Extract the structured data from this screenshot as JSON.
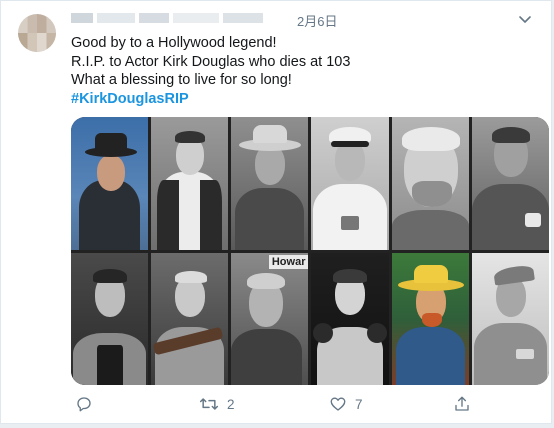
{
  "tweet": {
    "date": "2月6日",
    "lines": [
      "Good by to a Hollywood legend!",
      "R.I.P. to Actor Kirk Douglas who dies at 103",
      "What a blessing to live for so long!"
    ],
    "hashtag": "#KirkDouglasRIP",
    "image_poster_text": "Howar"
  },
  "actions": {
    "reply_count": "",
    "retweet_count": "2",
    "like_count": "7"
  },
  "colors": {
    "accent": "#1b95e0",
    "text": "#14171a",
    "muted": "#657786"
  },
  "icons": [
    "chevron-down-icon",
    "reply-icon",
    "retweet-icon",
    "like-icon",
    "share-icon"
  ]
}
